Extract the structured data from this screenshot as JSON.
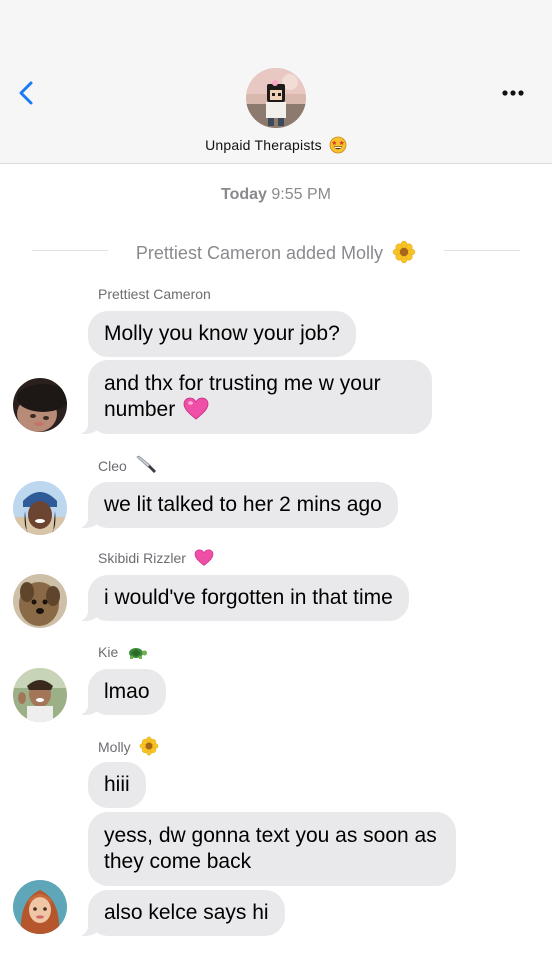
{
  "header": {
    "group_name": "Unpaid Therapists",
    "group_emoji_icon": "star-struck-face-icon",
    "back_icon": "chevron-left-icon",
    "more_icon": "ellipsis-icon"
  },
  "conversation": {
    "timestamp_day": "Today",
    "timestamp_time": "9:55 PM",
    "system_message": "Prettiest Cameron added Molly",
    "system_message_icon": "sunflower-icon"
  },
  "messages": {
    "cameron": {
      "sender": "Prettiest Cameron",
      "m1": "Molly you know your job?",
      "m2": "and thx for trusting me w your number",
      "m2_icon": "pink-heart-icon"
    },
    "cleo": {
      "sender": "Cleo",
      "sender_icon": "knife-icon",
      "m1": "we lit talked to her 2 mins ago"
    },
    "skibidi": {
      "sender": "Skibidi Rizzler",
      "sender_icon": "pink-heart-icon",
      "m1": "i would've forgotten in that time"
    },
    "kie": {
      "sender": "Kie",
      "sender_icon": "turtle-icon",
      "m1": "lmao"
    },
    "molly": {
      "sender": "Molly",
      "sender_icon": "sunflower-icon",
      "m1": "hiii",
      "m2": "yess, dw gonna text you as soon as they come back",
      "m3": "also kelce says hi"
    }
  },
  "colors": {
    "accent": "#1a7cf5",
    "bubble_received": "#e9e9eb",
    "header_bg": "#f6f6f7",
    "meta_text": "#8a8a8e"
  }
}
